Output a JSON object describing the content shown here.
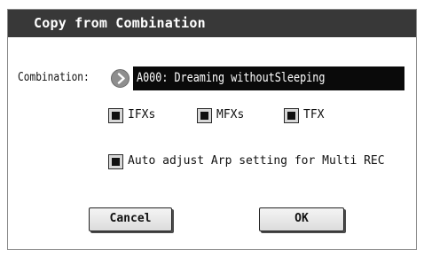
{
  "dialog": {
    "title": "Copy from Combination"
  },
  "combination": {
    "label": "Combination:",
    "value": "A000: Dreaming withoutSleeping",
    "select_icon": "chevron-right-circle-icon"
  },
  "options": {
    "ifxs": {
      "label": "IFXs",
      "checked": true
    },
    "mfxs": {
      "label": "MFXs",
      "checked": true
    },
    "tfx": {
      "label": "TFX",
      "checked": true
    },
    "auto_adjust": {
      "label": "Auto adjust Arp setting for Multi REC",
      "checked": true
    }
  },
  "buttons": {
    "cancel": "Cancel",
    "ok": "OK"
  },
  "colors": {
    "titlebar": "#383838",
    "value_box": "#0a0a0a",
    "checkbox_fill": "#d8d8d8",
    "arrow_button": "#8e8e8e"
  }
}
